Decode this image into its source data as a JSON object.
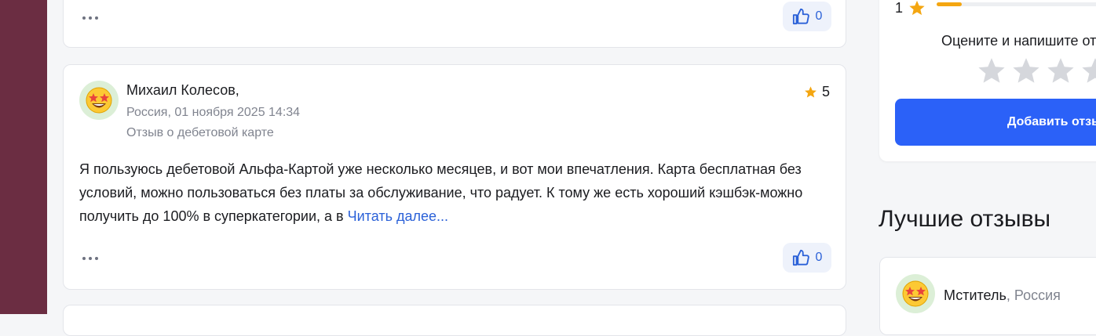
{
  "prev_review": {
    "likes": "0"
  },
  "review": {
    "author": "Михаил Колесов,",
    "date": "Россия, 01 ноября 2025 14:34",
    "type": "Отзыв о дебетовой карте",
    "rating": "5",
    "text": "Я пользуюсь дебетовой Альфа-Картой уже несколько месяцев, и вот мои впечатления. Карта бесплатная без условий, можно пользоваться без платы за обслуживание, что радует. К тому же есть хороший кэшбэк-можно получить до 100% в суперкатегории, а в ",
    "read_more": "Читать далее...",
    "likes": "0"
  },
  "sidebar": {
    "hist_label": "1",
    "hist_fraction": 0.14,
    "rate_prompt": "Оцените и напишите отзыв",
    "add_button": "Добавить отзыв",
    "best_title": "Лучшие отзывы",
    "best_author": "Мститель",
    "best_sep": ", ",
    "best_country": "Россия"
  },
  "colors": {
    "accent": "#2b61f8",
    "star": "#f4a611",
    "brand_bar": "#6b2d42"
  },
  "icons": {
    "like": "thumbs-up-icon",
    "star": "star-icon",
    "more": "more-dots-icon",
    "avatar": "star-struck-emoji-icon"
  }
}
